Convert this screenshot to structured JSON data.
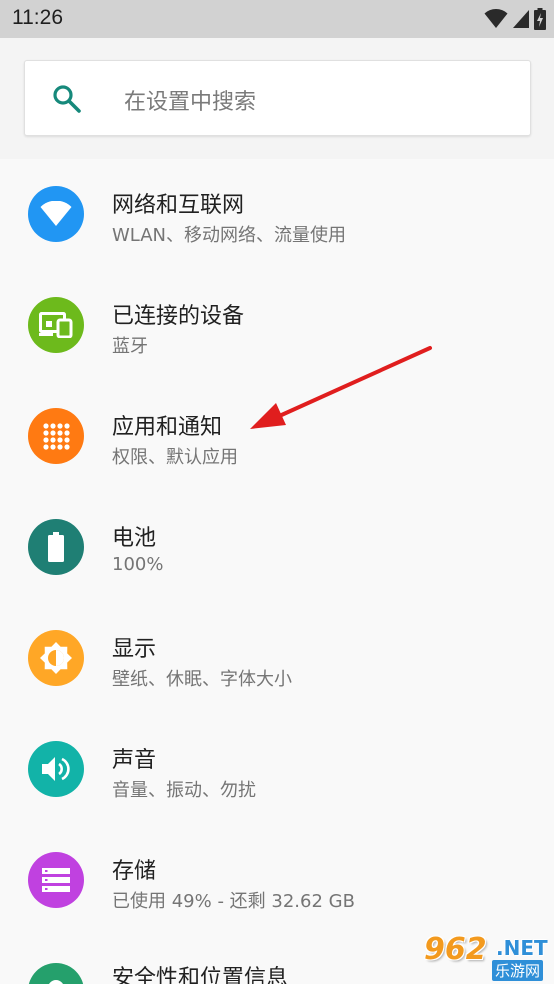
{
  "status": {
    "time": "11:26"
  },
  "search": {
    "placeholder": "在设置中搜索"
  },
  "items": [
    {
      "title": "网络和互联网",
      "subtitle": "WLAN、移动网络、流量使用",
      "icon": "wifi-icon",
      "color": "#2196F3"
    },
    {
      "title": "已连接的设备",
      "subtitle": "蓝牙",
      "icon": "devices-icon",
      "color": "#6DBA1C"
    },
    {
      "title": "应用和通知",
      "subtitle": "权限、默认应用",
      "icon": "apps-icon",
      "color": "#FF7A12"
    },
    {
      "title": "电池",
      "subtitle": "100%",
      "icon": "battery-icon",
      "color": "#1F7F74"
    },
    {
      "title": "显示",
      "subtitle": "壁纸、休眠、字体大小",
      "icon": "brightness-icon",
      "color": "#FFA726"
    },
    {
      "title": "声音",
      "subtitle": "音量、振动、勿扰",
      "icon": "volume-icon",
      "color": "#12B3A8"
    },
    {
      "title": "存储",
      "subtitle": "已使用 49% - 还剩 32.62 GB",
      "icon": "storage-icon",
      "color": "#C041E0"
    },
    {
      "title": "安全性和位置信息",
      "subtitle": "",
      "icon": "security-icon",
      "color": "#25A06C"
    }
  ],
  "watermark": {
    "num": "962",
    "net": ".NET",
    "sub": "乐游网"
  }
}
